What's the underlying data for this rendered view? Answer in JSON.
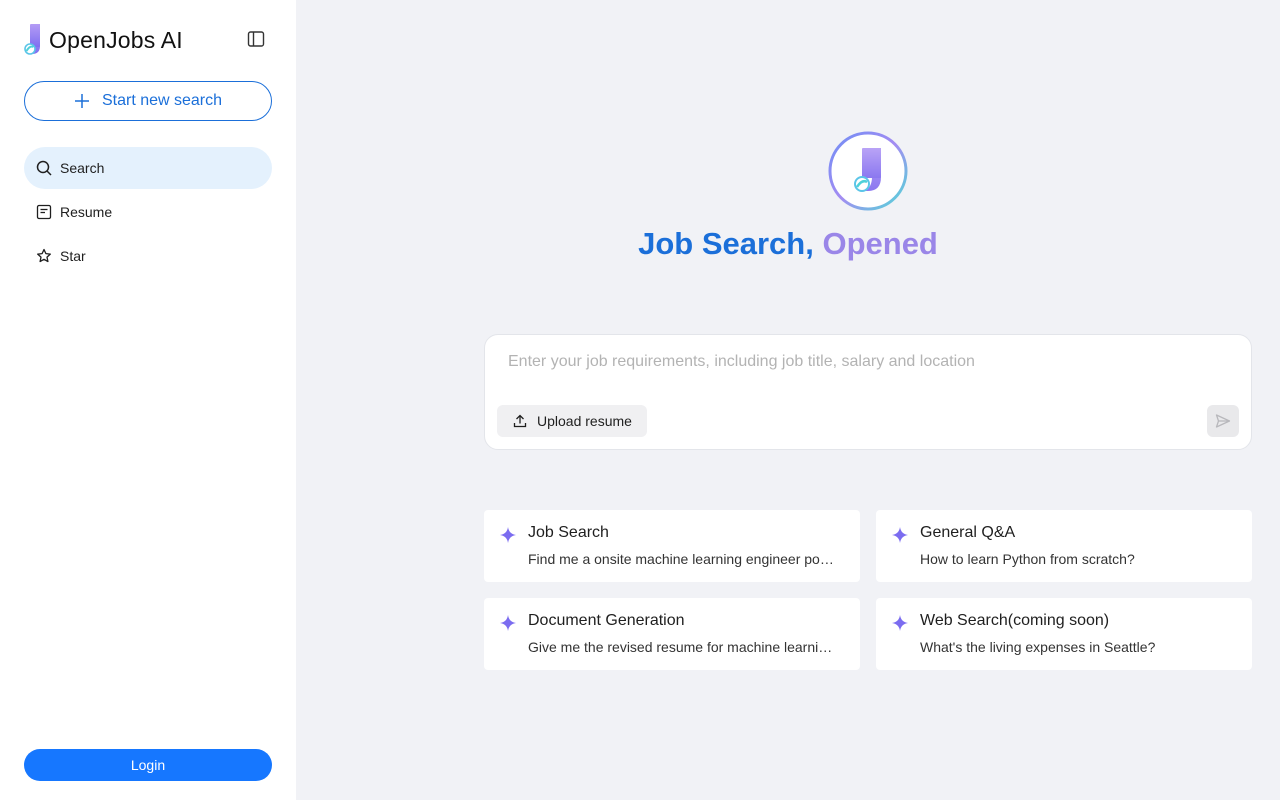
{
  "brand": {
    "name": "OpenJobs AI"
  },
  "sidebar": {
    "new_search_label": "Start new search",
    "items": [
      {
        "label": "Search",
        "icon": "search-icon",
        "active": true
      },
      {
        "label": "Resume",
        "icon": "resume-icon",
        "active": false
      },
      {
        "label": "Star",
        "icon": "star-icon",
        "active": false
      }
    ],
    "login_label": "Login"
  },
  "hero": {
    "title_part1": "Job Search, ",
    "title_part2": "Opened"
  },
  "composer": {
    "placeholder": "Enter your job requirements, including job title, salary and location",
    "value": "",
    "upload_label": "Upload resume"
  },
  "suggestions": [
    {
      "title": "Job Search",
      "desc": "Find me a onsite machine learning engineer position"
    },
    {
      "title": "General Q&A",
      "desc": "How to learn Python from scratch?"
    },
    {
      "title": "Document Generation",
      "desc": "Give me the revised resume for machine learning engineer"
    },
    {
      "title": "Web Search(coming soon)",
      "desc": "What's the living expenses in Seattle?"
    }
  ],
  "colors": {
    "primary": "#1677ff",
    "brand_blue": "#1b6fd9",
    "brand_purple": "#9a86e8",
    "active_bg": "#e4f1fd",
    "page_bg": "#f1f2f6"
  }
}
